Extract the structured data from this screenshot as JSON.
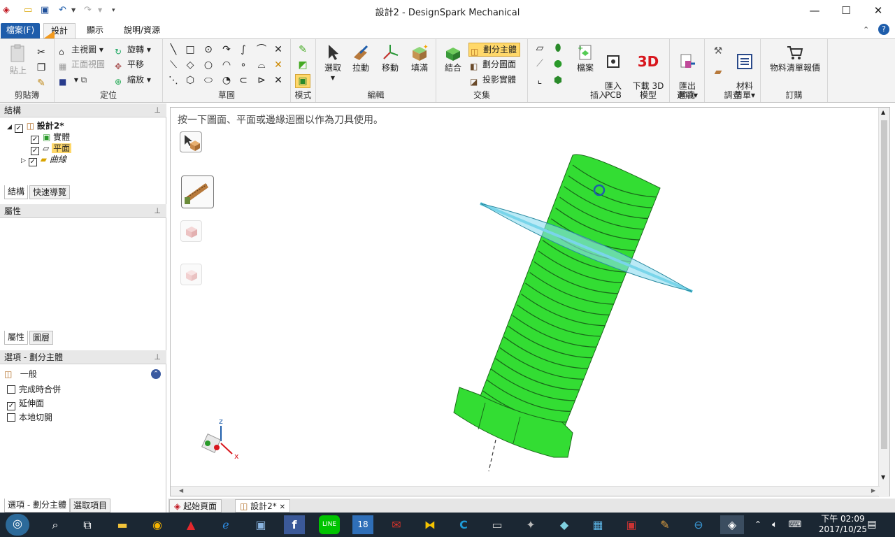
{
  "window": {
    "title": "設計2 - DesignSpark Mechanical"
  },
  "ribbon_tabs": {
    "file": "檔案(F)",
    "design": "設計",
    "display": "顯示",
    "help": "說明/資源"
  },
  "clipboard": {
    "paste": "貼上",
    "label": "剪貼簿"
  },
  "orient": {
    "home_view": "主視圖",
    "front_view": "正面視圖",
    "rotate": "旋轉",
    "pan": "平移",
    "zoom": "縮放",
    "label": "定位"
  },
  "sketch": {
    "label": "草圖"
  },
  "mode": {
    "label": "模式"
  },
  "edit": {
    "select": "選取",
    "pull": "拉動",
    "move": "移動",
    "fill": "填滿",
    "label": "編輯"
  },
  "intersect": {
    "combine": "結合",
    "split_body": "劃分主體",
    "split_face": "劃分圖面",
    "project": "投影實體",
    "label": "交集"
  },
  "insert": {
    "file": "檔案",
    "import_pcb": "匯入\nPCB",
    "download_3d": "下載 3D\n模型",
    "label": "插入"
  },
  "output": {
    "export": "匯出\n選項",
    "label": "輸出"
  },
  "investigate": {
    "bom": "材料\n清單",
    "label": "調查"
  },
  "order": {
    "bom_quote": "物料清單報價",
    "label": "訂購"
  },
  "structure": {
    "header": "結構",
    "root": "設計2*",
    "solid": "實體",
    "plane": "平面",
    "curves": "曲線",
    "tab_structure": "結構",
    "tab_quicknav": "快速導覽"
  },
  "properties": {
    "header": "屬性",
    "tab_props": "屬性",
    "tab_layers": "圖層"
  },
  "options": {
    "header": "選項 - 劃分主體",
    "section": "一般",
    "merge": "完成時合併",
    "extend": "延伸面",
    "local": "本地切開",
    "tab_options": "選項 - 劃分主體",
    "tab_select": "選取項目"
  },
  "viewport": {
    "hint": "按一下圖面、平面或邊緣迴圈以作為刀具使用。",
    "axis_z": "z",
    "axis_x": "x"
  },
  "doc_tabs": {
    "start": "起始頁面",
    "design": "設計2*"
  },
  "taskbar": {
    "time": "下午 02:09",
    "date": "2017/10/25",
    "calendar_day": "18"
  },
  "colors": {
    "accent": "#1e5dab",
    "model": "#33dd33",
    "plane": "#5ccbe0"
  }
}
